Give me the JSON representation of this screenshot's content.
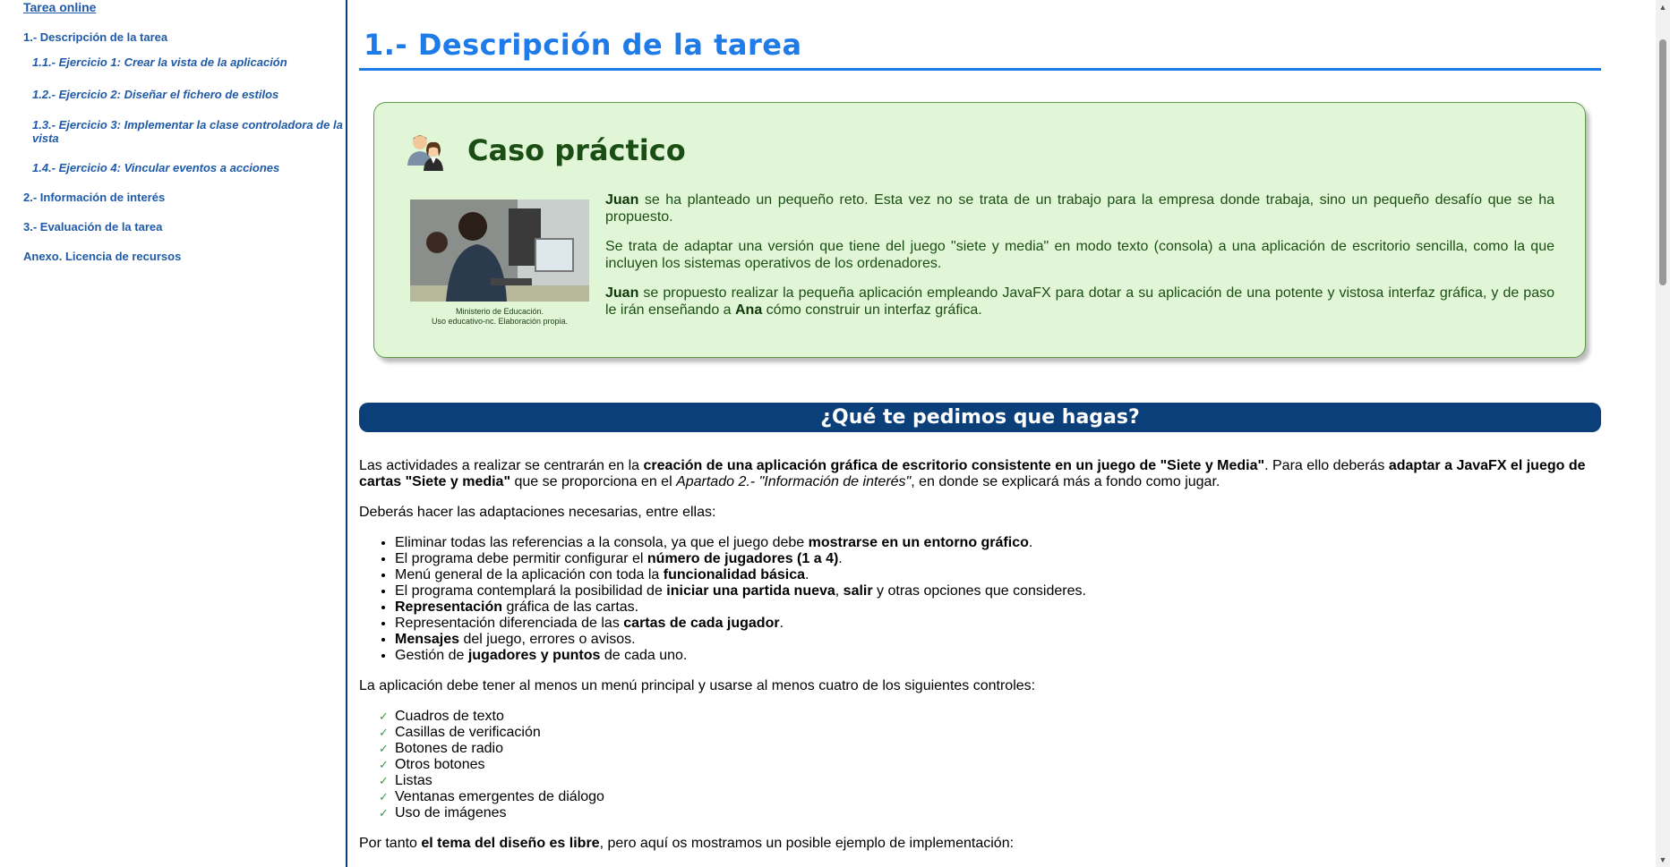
{
  "sidebar": {
    "top_link": "Tarea online",
    "items": [
      {
        "label": "1.- Descripción de la tarea"
      },
      {
        "label": "1.1.- Ejercicio 1: Crear la vista de la aplicación"
      },
      {
        "label": "1.2.- Ejercicio 2: Diseñar el fichero de estilos"
      },
      {
        "label": "1.3.- Ejercicio 3: Implementar la clase controladora de la vista"
      },
      {
        "label": "1.4.- Ejercicio 4: Vincular eventos a acciones"
      },
      {
        "label": "2.- Información de interés"
      },
      {
        "label": "3.- Evaluación de la tarea"
      },
      {
        "label": "Anexo. Licencia de recursos"
      }
    ]
  },
  "main": {
    "title": "1.- Descripción de la tarea",
    "case": {
      "title": "Caso práctico",
      "photo_caption": "Ministerio de Educación.\nUso educativo-nc. Elaboración propia.",
      "p1_name": "Juan",
      "p1_text": " se ha planteado un pequeño reto. Esta vez no se trata de un trabajo para la empresa donde trabaja, sino un pequeño desafío que se ha propuesto.",
      "p2_text": "Se trata de adaptar una versión que tiene del juego \"siete y media\" en modo texto (consola) a una aplicación de escritorio sencilla, como la que incluyen los sistemas operativos de los ordenadores.",
      "p3_name": "Juan",
      "p3_text_a": " se propuesto realizar la pequeña aplicación empleando JavaFX para dotar a su aplicación de una potente y vistosa interfaz gráfica, y de paso le irán enseñando a ",
      "p3_name2": "Ana",
      "p3_text_b": " cómo construir un interfaz gráfica."
    },
    "banner": "¿Qué te pedimos que hagas?",
    "intro": {
      "a": "Las actividades a realizar se centrarán en la ",
      "b": "creación de una aplicación gráfica de escritorio consistente en un juego de \"Siete y Media\"",
      "c": ". Para ello deberás ",
      "d": "adaptar a JavaFX el juego de cartas  \"Siete y media\"",
      "e": " que se proporciona en el ",
      "f": "Apartado 2.- \"Información de interés\"",
      "g": ", en donde se explicará más a fondo como jugar."
    },
    "adapt_intro": "Deberás hacer las adaptaciones necesarias, entre ellas:",
    "bullets": [
      {
        "a": "Eliminar todas las referencias a la consola, ya que el juego debe ",
        "b": "mostrarse en un entorno gráfico",
        "c": "."
      },
      {
        "a": "El programa debe permitir configurar el ",
        "b": "número de jugadores (1 a 4)",
        "c": "."
      },
      {
        "a": "Menú general de la aplicación con toda la ",
        "b": "funcionalidad básica",
        "c": "."
      },
      {
        "a": "El programa contemplará la posibilidad de ",
        "b": "iniciar una partida nueva",
        "c": ", ",
        "d": "salir",
        "e": " y otras opciones que consideres."
      },
      {
        "a": "",
        "b": "Representación",
        "c": " gráfica de las cartas."
      },
      {
        "a": "Representación diferenciada de las ",
        "b": "cartas de cada jugador",
        "c": "."
      },
      {
        "a": "",
        "b": "Mensajes",
        "c": " del juego, errores o avisos."
      },
      {
        "a": "Gestión de ",
        "b": "jugadores y puntos",
        "c": " de cada uno."
      }
    ],
    "controls_intro": "La aplicación debe tener al menos un menú principal y usarse al menos cuatro de los siguientes controles:",
    "controls": [
      "Cuadros de texto",
      "Casillas de verificación",
      "Botones de radio",
      "Otros botones",
      "Listas",
      "Ventanas emergentes de diálogo",
      "Uso de imágenes"
    ],
    "closing": {
      "a": "Por tanto ",
      "b": "el tema del diseño es libre",
      "c": ", pero aquí os mostramos un posible ejemplo de implementación:"
    }
  },
  "icons": {
    "case": "users-icon",
    "check": "checkmark-icon"
  },
  "colors": {
    "title": "#1e7be8",
    "banner": "#0a3f7a",
    "case_bg": "#e1f6d6",
    "case_text": "#1b4e14",
    "nav": "#1f5aa8"
  }
}
